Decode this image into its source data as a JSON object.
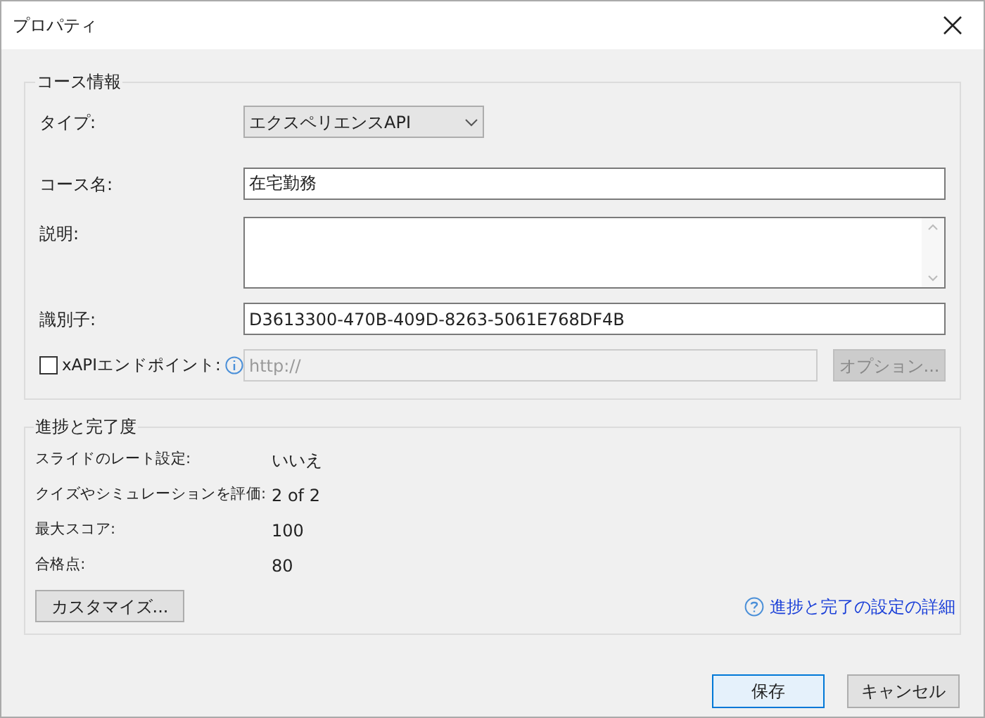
{
  "window": {
    "title": "プロパティ"
  },
  "course_info": {
    "legend": "コース情報",
    "type": {
      "label": "タイプ:",
      "value": "エクスペリエンスAPI"
    },
    "name": {
      "label": "コース名:",
      "value": "在宅勤務"
    },
    "description": {
      "label": "説明:"
    },
    "identifier": {
      "label": "識別子:",
      "value": "D3613300-470B-409D-8263-5061E768DF4B"
    },
    "xapi": {
      "label": "xAPIエンドポイント:",
      "checked": false,
      "placeholder": "http://",
      "disabled": true,
      "options_button": "オプション...",
      "options_disabled": true
    }
  },
  "progress": {
    "legend": "進捗と完了度",
    "rows": [
      {
        "label": "スライドのレート設定:",
        "value": "いいえ"
      },
      {
        "label": "クイズやシミュレーションを評価:",
        "value": "2 of 2"
      },
      {
        "label": "最大スコア:",
        "value": "100"
      },
      {
        "label": "合格点:",
        "value": "80"
      }
    ],
    "customize_button": "カスタマイズ...",
    "help_link": "進捗と完了の設定の詳細"
  },
  "buttons": [
    {
      "label": "保存",
      "focused": true
    },
    {
      "label": "キャンセル",
      "focused": false
    }
  ]
}
